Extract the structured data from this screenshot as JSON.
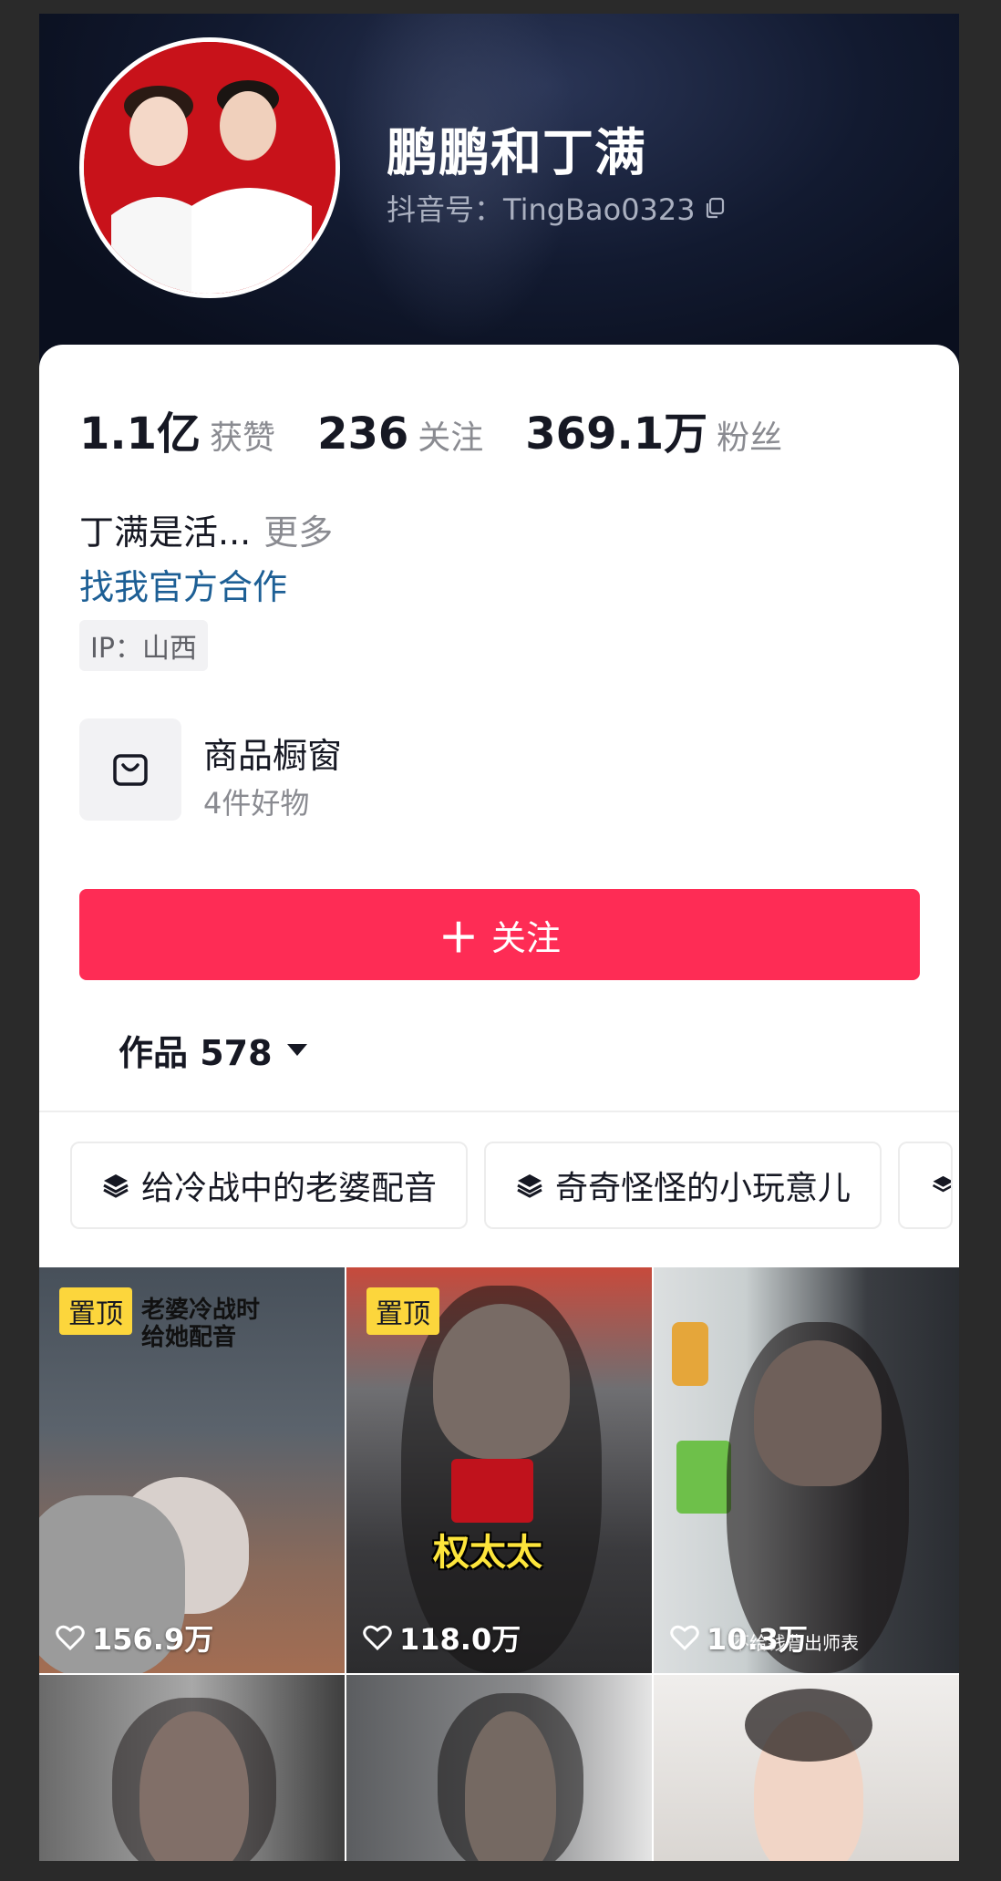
{
  "profile": {
    "nickname": "鹏鹏和丁满",
    "douyin_id": "抖音号：TingBao0323",
    "stats": [
      {
        "value": "1.1亿",
        "label": "获赞"
      },
      {
        "value": "236",
        "label": "关注"
      },
      {
        "value": "369.1万",
        "label": "粉丝"
      }
    ],
    "bio": "丁满是活...",
    "bio_more": "更多",
    "official_link": "找我官方合作",
    "ip": "IP：山西"
  },
  "shop": {
    "title": "商品橱窗",
    "subtitle": "4件好物"
  },
  "follow_button": {
    "label": "关注"
  },
  "works_tab": {
    "label": "作品 578"
  },
  "collections": [
    {
      "label": "给冷战中的老婆配音"
    },
    {
      "label": "奇奇怪怪的小玩意儿"
    }
  ],
  "videos": [
    {
      "pinned": "置顶",
      "overlay": "老婆冷战时\n给她配音",
      "likes": "156.9万"
    },
    {
      "pinned": "置顶",
      "caption": "权太太",
      "likes": "118.0万"
    },
    {
      "caption_small": "不给钱背出师表",
      "likes": "10.3万"
    }
  ],
  "colors": {
    "accent": "#fe2c55",
    "link": "#1d5f95",
    "pin": "#fcd63c"
  }
}
